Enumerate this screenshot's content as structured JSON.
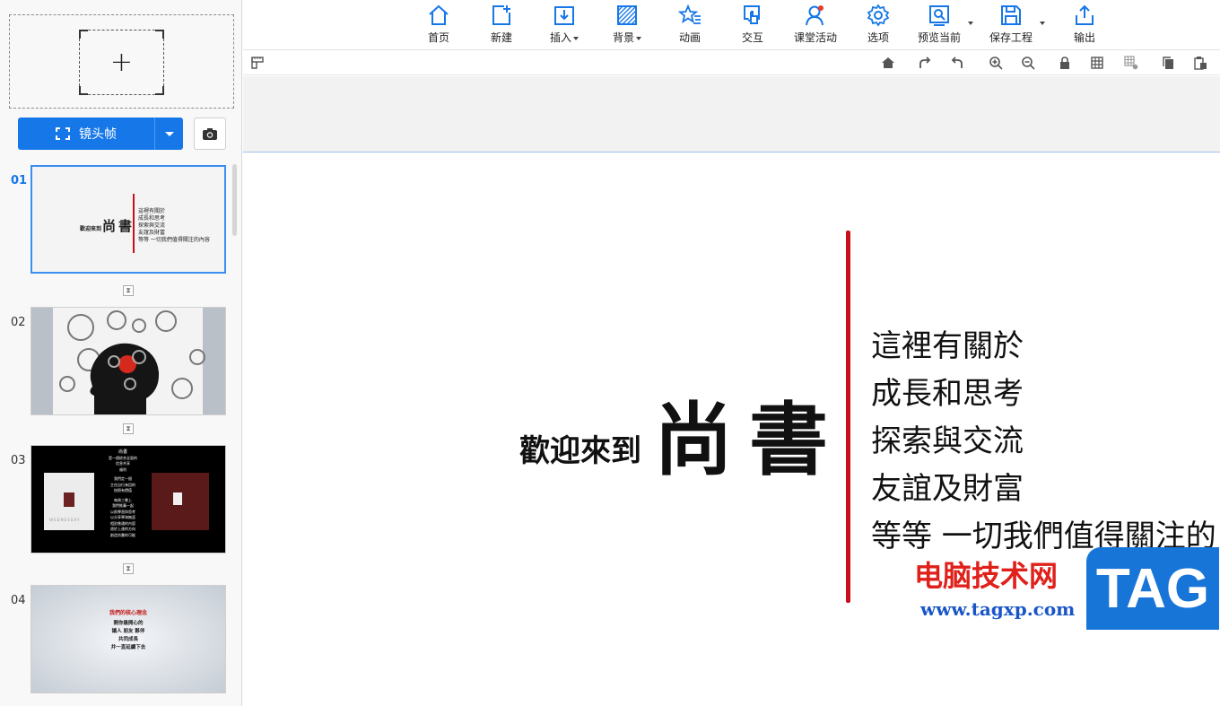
{
  "left_panel": {
    "add_frame_symbol": "+",
    "lens_button_label": "镜头帧",
    "slides": [
      {
        "num": "01",
        "active": true,
        "welcome": "歡迎來到",
        "title": "尚書",
        "lines": [
          "這裡有關於",
          "成長和思考",
          "探索與交流",
          "友誼及財富",
          "等等 一切我們值得關注的內容"
        ]
      },
      {
        "num": "02",
        "active": false
      },
      {
        "num": "03",
        "active": false,
        "lines": [
          "尚書",
          "是一個綜合全面的",
          "信息共享",
          "福利",
          "我們定一個",
          "主任自行來回的",
          "校照有價值",
          "每周三晚上",
          "我們推薦一起",
          "以前學習與思考",
          "以分享學海無涯",
          "相對普通的內容",
          "遊於上達的方向",
          "創造尚書的可能"
        ],
        "caption": "WEDNESDAY"
      },
      {
        "num": "04",
        "active": false,
        "heading": "我們的核心理念",
        "lines": [
          "開你最開心的",
          "讓人 朋友 夥伴",
          "共同成長",
          "并一直延續下去"
        ]
      }
    ]
  },
  "toolbar": {
    "tools": [
      {
        "label": "首页",
        "icon": "home-icon"
      },
      {
        "label": "新建",
        "icon": "new-slide-icon"
      },
      {
        "label": "插入",
        "icon": "insert-icon",
        "dropdown": true
      },
      {
        "label": "背景",
        "icon": "background-icon",
        "dropdown": true
      },
      {
        "label": "动画",
        "icon": "animation-icon"
      },
      {
        "label": "交互",
        "icon": "interaction-icon"
      },
      {
        "label": "课堂活动",
        "icon": "classroom-activity-icon"
      },
      {
        "label": "选项",
        "icon": "gear-icon"
      },
      {
        "label": "预览当前",
        "icon": "preview-icon"
      },
      {
        "label": "保存工程",
        "icon": "save-icon"
      },
      {
        "label": "输出",
        "icon": "export-icon"
      }
    ]
  },
  "canvas": {
    "welcome": "歡迎來到",
    "title": "尚書",
    "lines": [
      "這裡有關於",
      "成長和思考",
      "探索與交流",
      "友誼及財富",
      "等等  一切我們值得關注的"
    ]
  },
  "watermark": {
    "cn": "电脑技术网",
    "url": "www.tagxp.com",
    "tag": "TAG"
  },
  "colors": {
    "accent": "#1677e8",
    "title_bar": "#c80f1c"
  }
}
